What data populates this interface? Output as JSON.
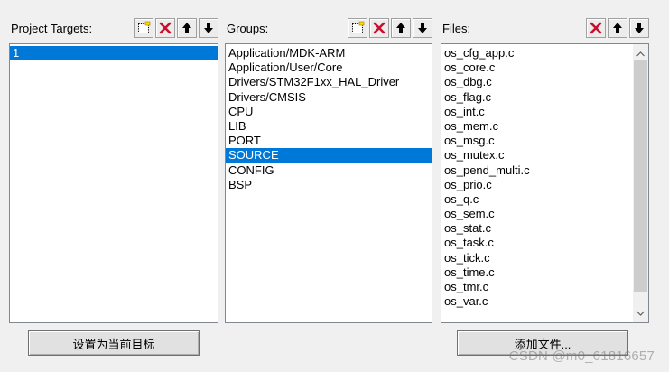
{
  "targets": {
    "title": "Project Targets:",
    "items": [
      "1"
    ],
    "selected_index": 0
  },
  "groups": {
    "title": "Groups:",
    "items": [
      "Application/MDK-ARM",
      "Application/User/Core",
      "Drivers/STM32F1xx_HAL_Driver",
      "Drivers/CMSIS",
      "CPU",
      "LIB",
      "PORT",
      "SOURCE",
      "CONFIG",
      "BSP"
    ],
    "selected_index": 7
  },
  "files": {
    "title": "Files:",
    "items": [
      "os_cfg_app.c",
      "os_core.c",
      "os_dbg.c",
      "os_flag.c",
      "os_int.c",
      "os_mem.c",
      "os_msg.c",
      "os_mutex.c",
      "os_pend_multi.c",
      "os_prio.c",
      "os_q.c",
      "os_sem.c",
      "os_stat.c",
      "os_task.c",
      "os_tick.c",
      "os_time.c",
      "os_tmr.c",
      "os_var.c"
    ]
  },
  "buttons": {
    "set_current_target": "设置为当前目标",
    "add_files": "添加文件..."
  },
  "watermark": "CSDN @m0_61816657",
  "icons": {
    "new": "new-item-icon",
    "delete": "delete-x-icon",
    "up": "move-up-arrow-icon",
    "down": "move-down-arrow-icon"
  },
  "colors": {
    "selection": "#0078d7",
    "delete_red": "#c8102e",
    "background": "#f0f0f0"
  }
}
